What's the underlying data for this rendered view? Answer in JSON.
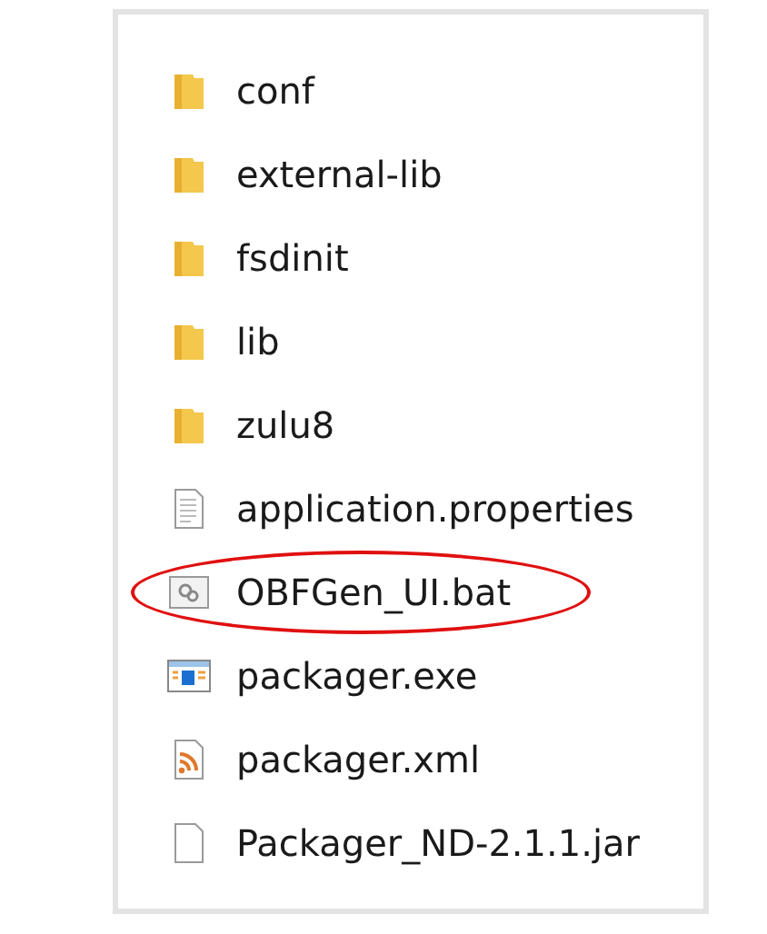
{
  "files": [
    {
      "name": "conf",
      "kind": "folder",
      "highlighted": false
    },
    {
      "name": "external-lib",
      "kind": "folder",
      "highlighted": false
    },
    {
      "name": "fsdinit",
      "kind": "folder",
      "highlighted": false
    },
    {
      "name": "lib",
      "kind": "folder",
      "highlighted": false
    },
    {
      "name": "zulu8",
      "kind": "folder",
      "highlighted": false
    },
    {
      "name": "application.properties",
      "kind": "text",
      "highlighted": false
    },
    {
      "name": "OBFGen_UI.bat",
      "kind": "batch",
      "highlighted": true
    },
    {
      "name": "packager.exe",
      "kind": "exe",
      "highlighted": false
    },
    {
      "name": "packager.xml",
      "kind": "xml",
      "highlighted": false
    },
    {
      "name": "Packager_ND-2.1.1.jar",
      "kind": "file",
      "highlighted": false
    }
  ]
}
